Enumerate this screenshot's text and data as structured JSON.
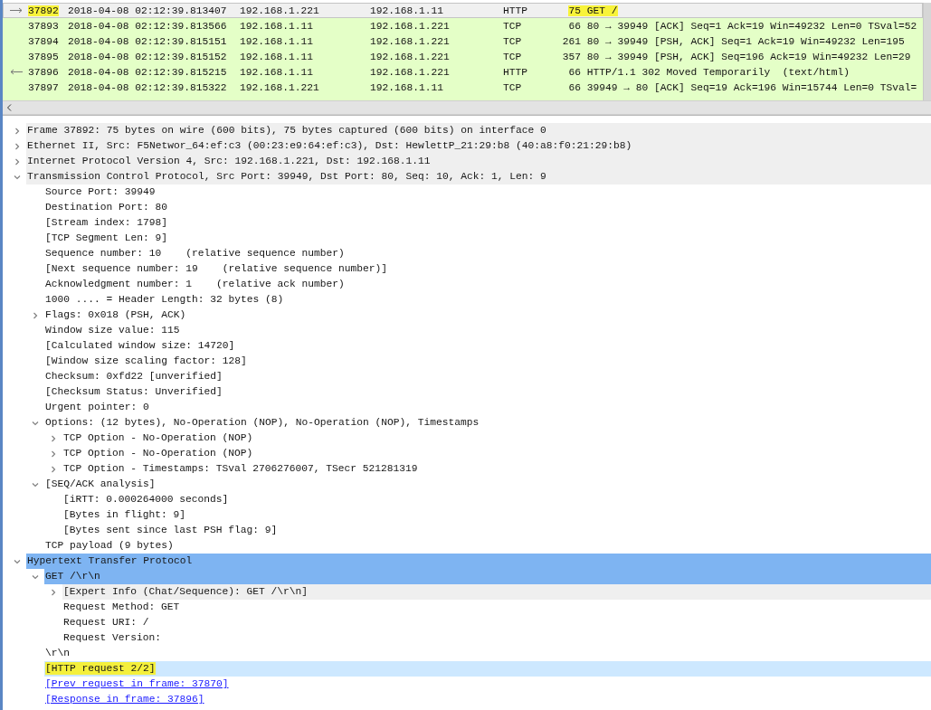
{
  "packet_list": {
    "rows": [
      {
        "no": "37892",
        "time": "2018-04-08 02:12:39.813407",
        "source": "192.168.1.221",
        "destination": "192.168.1.11",
        "protocol": "HTTP",
        "length": "75",
        "info": "GET /",
        "selected": true,
        "kind": "request",
        "marked": true
      },
      {
        "no": "37893",
        "time": "2018-04-08 02:12:39.813566",
        "source": "192.168.1.11",
        "destination": "192.168.1.221",
        "protocol": "TCP",
        "length": "66",
        "info": "80 → 39949 [ACK] Seq=1 Ack=19 Win=49232 Len=0 TSval=52",
        "selected": false,
        "kind": "plain",
        "marked": false
      },
      {
        "no": "37894",
        "time": "2018-04-08 02:12:39.815151",
        "source": "192.168.1.11",
        "destination": "192.168.1.221",
        "protocol": "TCP",
        "length": "261",
        "info": "80 → 39949 [PSH, ACK] Seq=1 Ack=19 Win=49232 Len=195",
        "selected": false,
        "kind": "plain",
        "marked": false
      },
      {
        "no": "37895",
        "time": "2018-04-08 02:12:39.815152",
        "source": "192.168.1.11",
        "destination": "192.168.1.221",
        "protocol": "TCP",
        "length": "357",
        "info": "80 → 39949 [PSH, ACK] Seq=196 Ack=19 Win=49232 Len=29",
        "selected": false,
        "kind": "plain",
        "marked": false
      },
      {
        "no": "37896",
        "time": "2018-04-08 02:12:39.815215",
        "source": "192.168.1.11",
        "destination": "192.168.1.221",
        "protocol": "HTTP",
        "length": "66",
        "info": "HTTP/1.1 302 Moved Temporarily  (text/html)",
        "selected": false,
        "kind": "response",
        "marked": false
      },
      {
        "no": "37897",
        "time": "2018-04-08 02:12:39.815322",
        "source": "192.168.1.221",
        "destination": "192.168.1.11",
        "protocol": "TCP",
        "length": "66",
        "info": "39949 → 80 [ACK] Seq=19 Ack=196 Win=15744 Len=0 TSval=",
        "selected": false,
        "kind": "plain",
        "marked": false
      }
    ]
  },
  "details": {
    "tree": [
      {
        "label": "Frame 37892: 75 bytes on wire (600 bits), 75 bytes captured (600 bits) on interface 0",
        "expanded": false,
        "selected": false,
        "shaded": true
      },
      {
        "label": "Ethernet II, Src: F5Networ_64:ef:c3 (00:23:e9:64:ef:c3), Dst: HewlettP_21:29:b8 (40:a8:f0:21:29:b8)",
        "expanded": false,
        "selected": false,
        "shaded": true
      },
      {
        "label": "Internet Protocol Version 4, Src: 192.168.1.221, Dst: 192.168.1.11",
        "expanded": false,
        "selected": false,
        "shaded": true
      },
      {
        "label": "Transmission Control Protocol, Src Port: 39949, Dst Port: 80, Seq: 10, Ack: 1, Len: 9",
        "expanded": true,
        "selected": false,
        "shaded": true,
        "children": [
          {
            "label": "Source Port: 39949",
            "selected": false
          },
          {
            "label": "Destination Port: 80",
            "selected": false
          },
          {
            "label": "[Stream index: 1798]",
            "selected": false
          },
          {
            "label": "[TCP Segment Len: 9]",
            "selected": false
          },
          {
            "label": "Sequence number: 10    (relative sequence number)",
            "selected": false
          },
          {
            "label": "[Next sequence number: 19    (relative sequence number)]",
            "selected": false
          },
          {
            "label": "Acknowledgment number: 1    (relative ack number)",
            "selected": false
          },
          {
            "label": "1000 .... = Header Length: 32 bytes (8)",
            "selected": false
          },
          {
            "label": "Flags: 0x018 (PSH, ACK)",
            "expanded": false,
            "selected": false
          },
          {
            "label": "Window size value: 115",
            "selected": false
          },
          {
            "label": "[Calculated window size: 14720]",
            "selected": false
          },
          {
            "label": "[Window size scaling factor: 128]",
            "selected": false
          },
          {
            "label": "Checksum: 0xfd22 [unverified]",
            "selected": false
          },
          {
            "label": "[Checksum Status: Unverified]",
            "selected": false
          },
          {
            "label": "Urgent pointer: 0",
            "selected": false
          },
          {
            "label": "Options: (12 bytes), No-Operation (NOP), No-Operation (NOP), Timestamps",
            "expanded": true,
            "selected": false,
            "children": [
              {
                "label": "TCP Option - No-Operation (NOP)",
                "expanded": false,
                "selected": false
              },
              {
                "label": "TCP Option - No-Operation (NOP)",
                "expanded": false,
                "selected": false
              },
              {
                "label": "TCP Option - Timestamps: TSval 2706276007, TSecr 521281319",
                "expanded": false,
                "selected": false
              }
            ]
          },
          {
            "label": "[SEQ/ACK analysis]",
            "expanded": true,
            "selected": false,
            "children": [
              {
                "label": "[iRTT: 0.000264000 seconds]",
                "selected": false
              },
              {
                "label": "[Bytes in flight: 9]",
                "selected": false
              },
              {
                "label": "[Bytes sent since last PSH flag: 9]",
                "selected": false
              }
            ]
          },
          {
            "label": "TCP payload (9 bytes)",
            "selected": false
          }
        ]
      },
      {
        "label": "Hypertext Transfer Protocol",
        "expanded": true,
        "selected": true,
        "children": [
          {
            "label": "GET /\\r\\n",
            "expanded": true,
            "selected": true,
            "children": [
              {
                "label": "[Expert Info (Chat/Sequence): GET /\\r\\n]",
                "expanded": false,
                "selected": false,
                "shaded": true
              },
              {
                "label": "Request Method: GET",
                "selected": false
              },
              {
                "label": "Request URI: /",
                "selected": false
              },
              {
                "label": "Request Version:",
                "selected": false
              }
            ]
          },
          {
            "label": "\\r\\n",
            "selected": false
          },
          {
            "label": "[HTTP request 2/2]",
            "selected": false,
            "hovered": true,
            "marked": true
          },
          {
            "label": "[Prev request in frame: 37870]",
            "selected": false,
            "kind": "link"
          },
          {
            "label": "[Response in frame: 37896]",
            "selected": false,
            "kind": "link"
          }
        ]
      }
    ]
  }
}
